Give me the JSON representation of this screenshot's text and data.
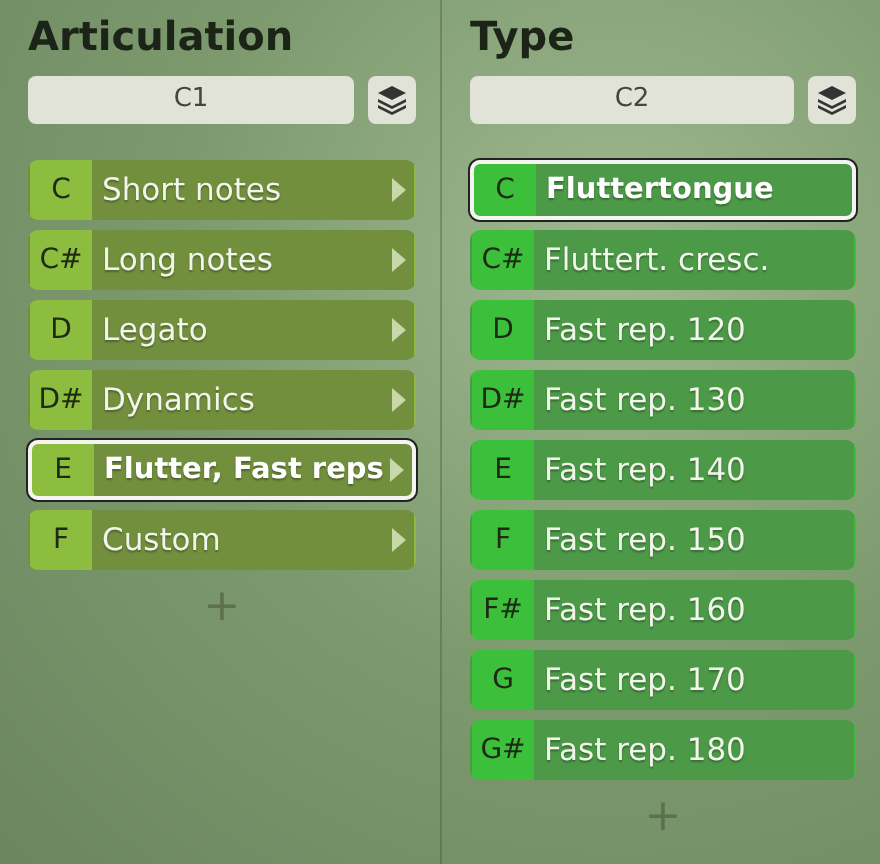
{
  "columns": [
    {
      "kind": "articulation",
      "title": "Articulation",
      "field": "C1",
      "items": [
        {
          "key": "C",
          "label": "Short notes",
          "selected": false,
          "submenu": true
        },
        {
          "key": "C#",
          "label": "Long notes",
          "selected": false,
          "submenu": true
        },
        {
          "key": "D",
          "label": "Legato",
          "selected": false,
          "submenu": true
        },
        {
          "key": "D#",
          "label": "Dynamics",
          "selected": false,
          "submenu": true
        },
        {
          "key": "E",
          "label": "Flutter, Fast reps",
          "selected": true,
          "submenu": true
        },
        {
          "key": "F",
          "label": "Custom",
          "selected": false,
          "submenu": true
        }
      ],
      "add": "+"
    },
    {
      "kind": "type",
      "title": "Type",
      "field": "C2",
      "items": [
        {
          "key": "C",
          "label": "Fluttertongue",
          "selected": true,
          "submenu": false
        },
        {
          "key": "C#",
          "label": "Fluttert. cresc.",
          "selected": false,
          "submenu": false
        },
        {
          "key": "D",
          "label": "Fast rep. 120",
          "selected": false,
          "submenu": false
        },
        {
          "key": "D#",
          "label": "Fast rep. 130",
          "selected": false,
          "submenu": false
        },
        {
          "key": "E",
          "label": "Fast rep. 140",
          "selected": false,
          "submenu": false
        },
        {
          "key": "F",
          "label": "Fast rep. 150",
          "selected": false,
          "submenu": false
        },
        {
          "key": "F#",
          "label": "Fast rep. 160",
          "selected": false,
          "submenu": false
        },
        {
          "key": "G",
          "label": "Fast rep. 170",
          "selected": false,
          "submenu": false
        },
        {
          "key": "G#",
          "label": "Fast rep. 180",
          "selected": false,
          "submenu": false
        }
      ],
      "add": "+"
    }
  ]
}
